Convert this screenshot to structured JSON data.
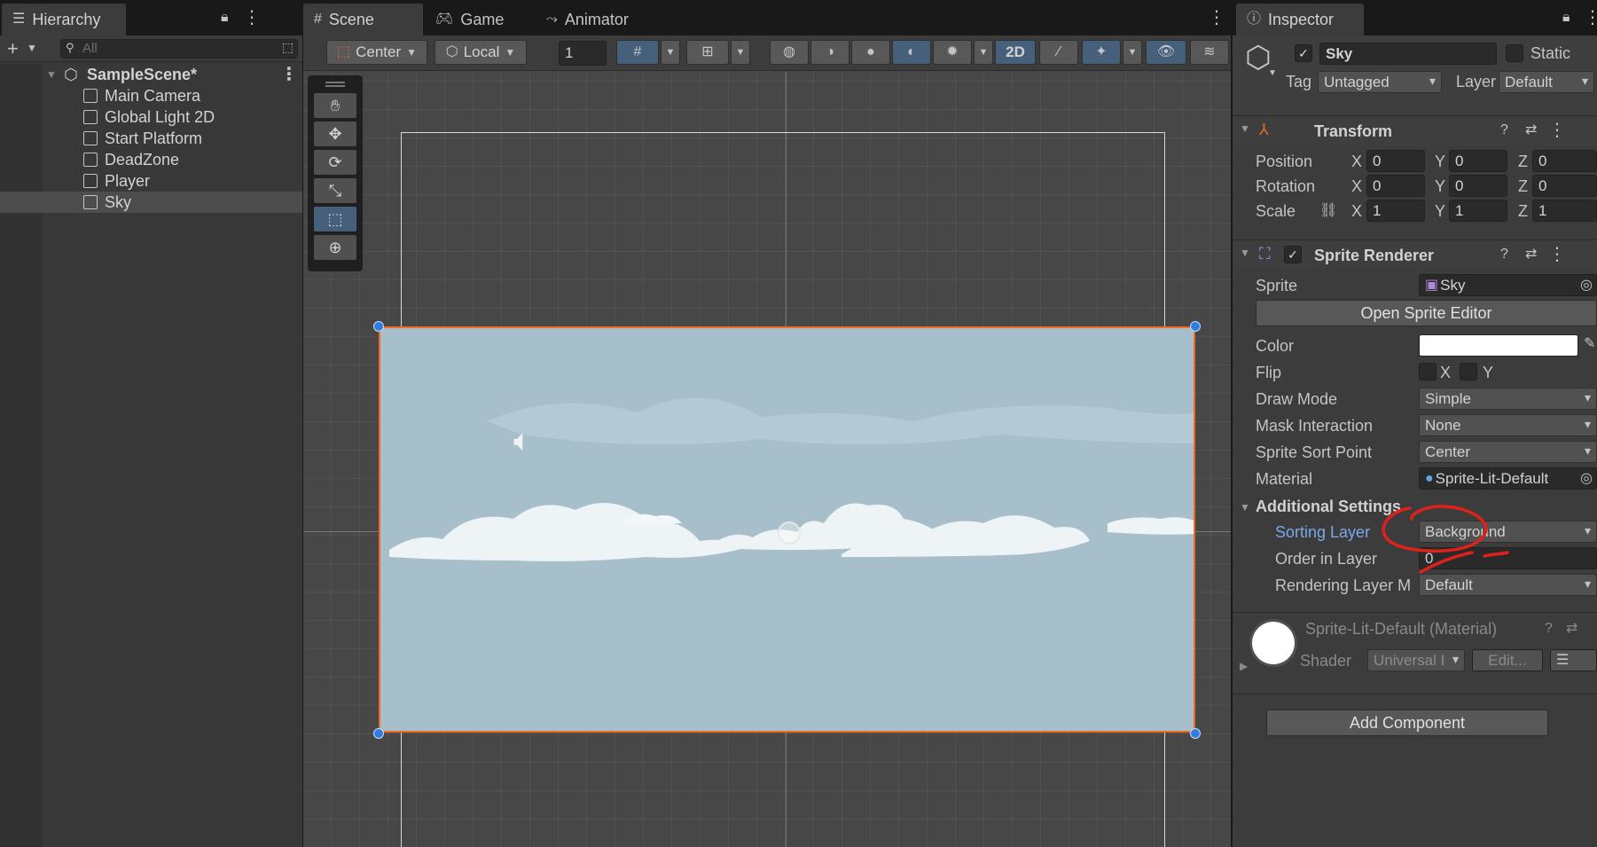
{
  "hierarchy": {
    "tab_label": "Hierarchy",
    "search_placeholder": "All",
    "scene_name": "SampleScene*",
    "items": [
      {
        "label": "Main Camera"
      },
      {
        "label": "Global Light 2D"
      },
      {
        "label": "Start Platform"
      },
      {
        "label": "DeadZone"
      },
      {
        "label": "Player"
      },
      {
        "label": "Sky",
        "selected": true
      }
    ]
  },
  "scene_tabs": {
    "scene": "Scene",
    "game": "Game",
    "animator": "Animator"
  },
  "scene_toolbar": {
    "pivot_mode": "Center",
    "pivot_rotation": "Local",
    "increment": "1",
    "mode_2d": "2D"
  },
  "inspector": {
    "tab_label": "Inspector",
    "object_name": "Sky",
    "static_label": "Static",
    "tag_label": "Tag",
    "tag_value": "Untagged",
    "layer_label": "Layer",
    "layer_value": "Default",
    "transform": {
      "title": "Transform",
      "position_label": "Position",
      "rotation_label": "Rotation",
      "scale_label": "Scale",
      "position": {
        "x": "0",
        "y": "0",
        "z": "0"
      },
      "rotation": {
        "x": "0",
        "y": "0",
        "z": "0"
      },
      "scale": {
        "x": "1",
        "y": "1",
        "z": "1"
      },
      "axis_x": "X",
      "axis_y": "Y",
      "axis_z": "Z"
    },
    "sprite_renderer": {
      "title": "Sprite Renderer",
      "sprite_label": "Sprite",
      "sprite_value": "Sky",
      "open_editor_label": "Open Sprite Editor",
      "color_label": "Color",
      "color_value": "#FFFFFF",
      "flip_label": "Flip",
      "flip_x": "X",
      "flip_y": "Y",
      "draw_mode_label": "Draw Mode",
      "draw_mode_value": "Simple",
      "mask_label": "Mask Interaction",
      "mask_value": "None",
      "sort_point_label": "Sprite Sort Point",
      "sort_point_value": "Center",
      "material_label": "Material",
      "material_value": "Sprite-Lit-Default",
      "additional_settings": "Additional Settings",
      "sorting_layer_label": "Sorting Layer",
      "sorting_layer_value": "Background",
      "order_label": "Order in Layer",
      "order_value": "0",
      "rendering_layer_label": "Rendering Layer M",
      "rendering_layer_value": "Default"
    },
    "material": {
      "title": "Sprite-Lit-Default (Material)",
      "shader_label": "Shader",
      "shader_value": "Universal I",
      "edit_label": "Edit..."
    },
    "add_component_label": "Add Component"
  },
  "colors": {
    "accent_blue": "#46607C",
    "selection_orange": "#F26B21",
    "sky": "#A7BFCA",
    "annotation_red": "#E0201B"
  }
}
